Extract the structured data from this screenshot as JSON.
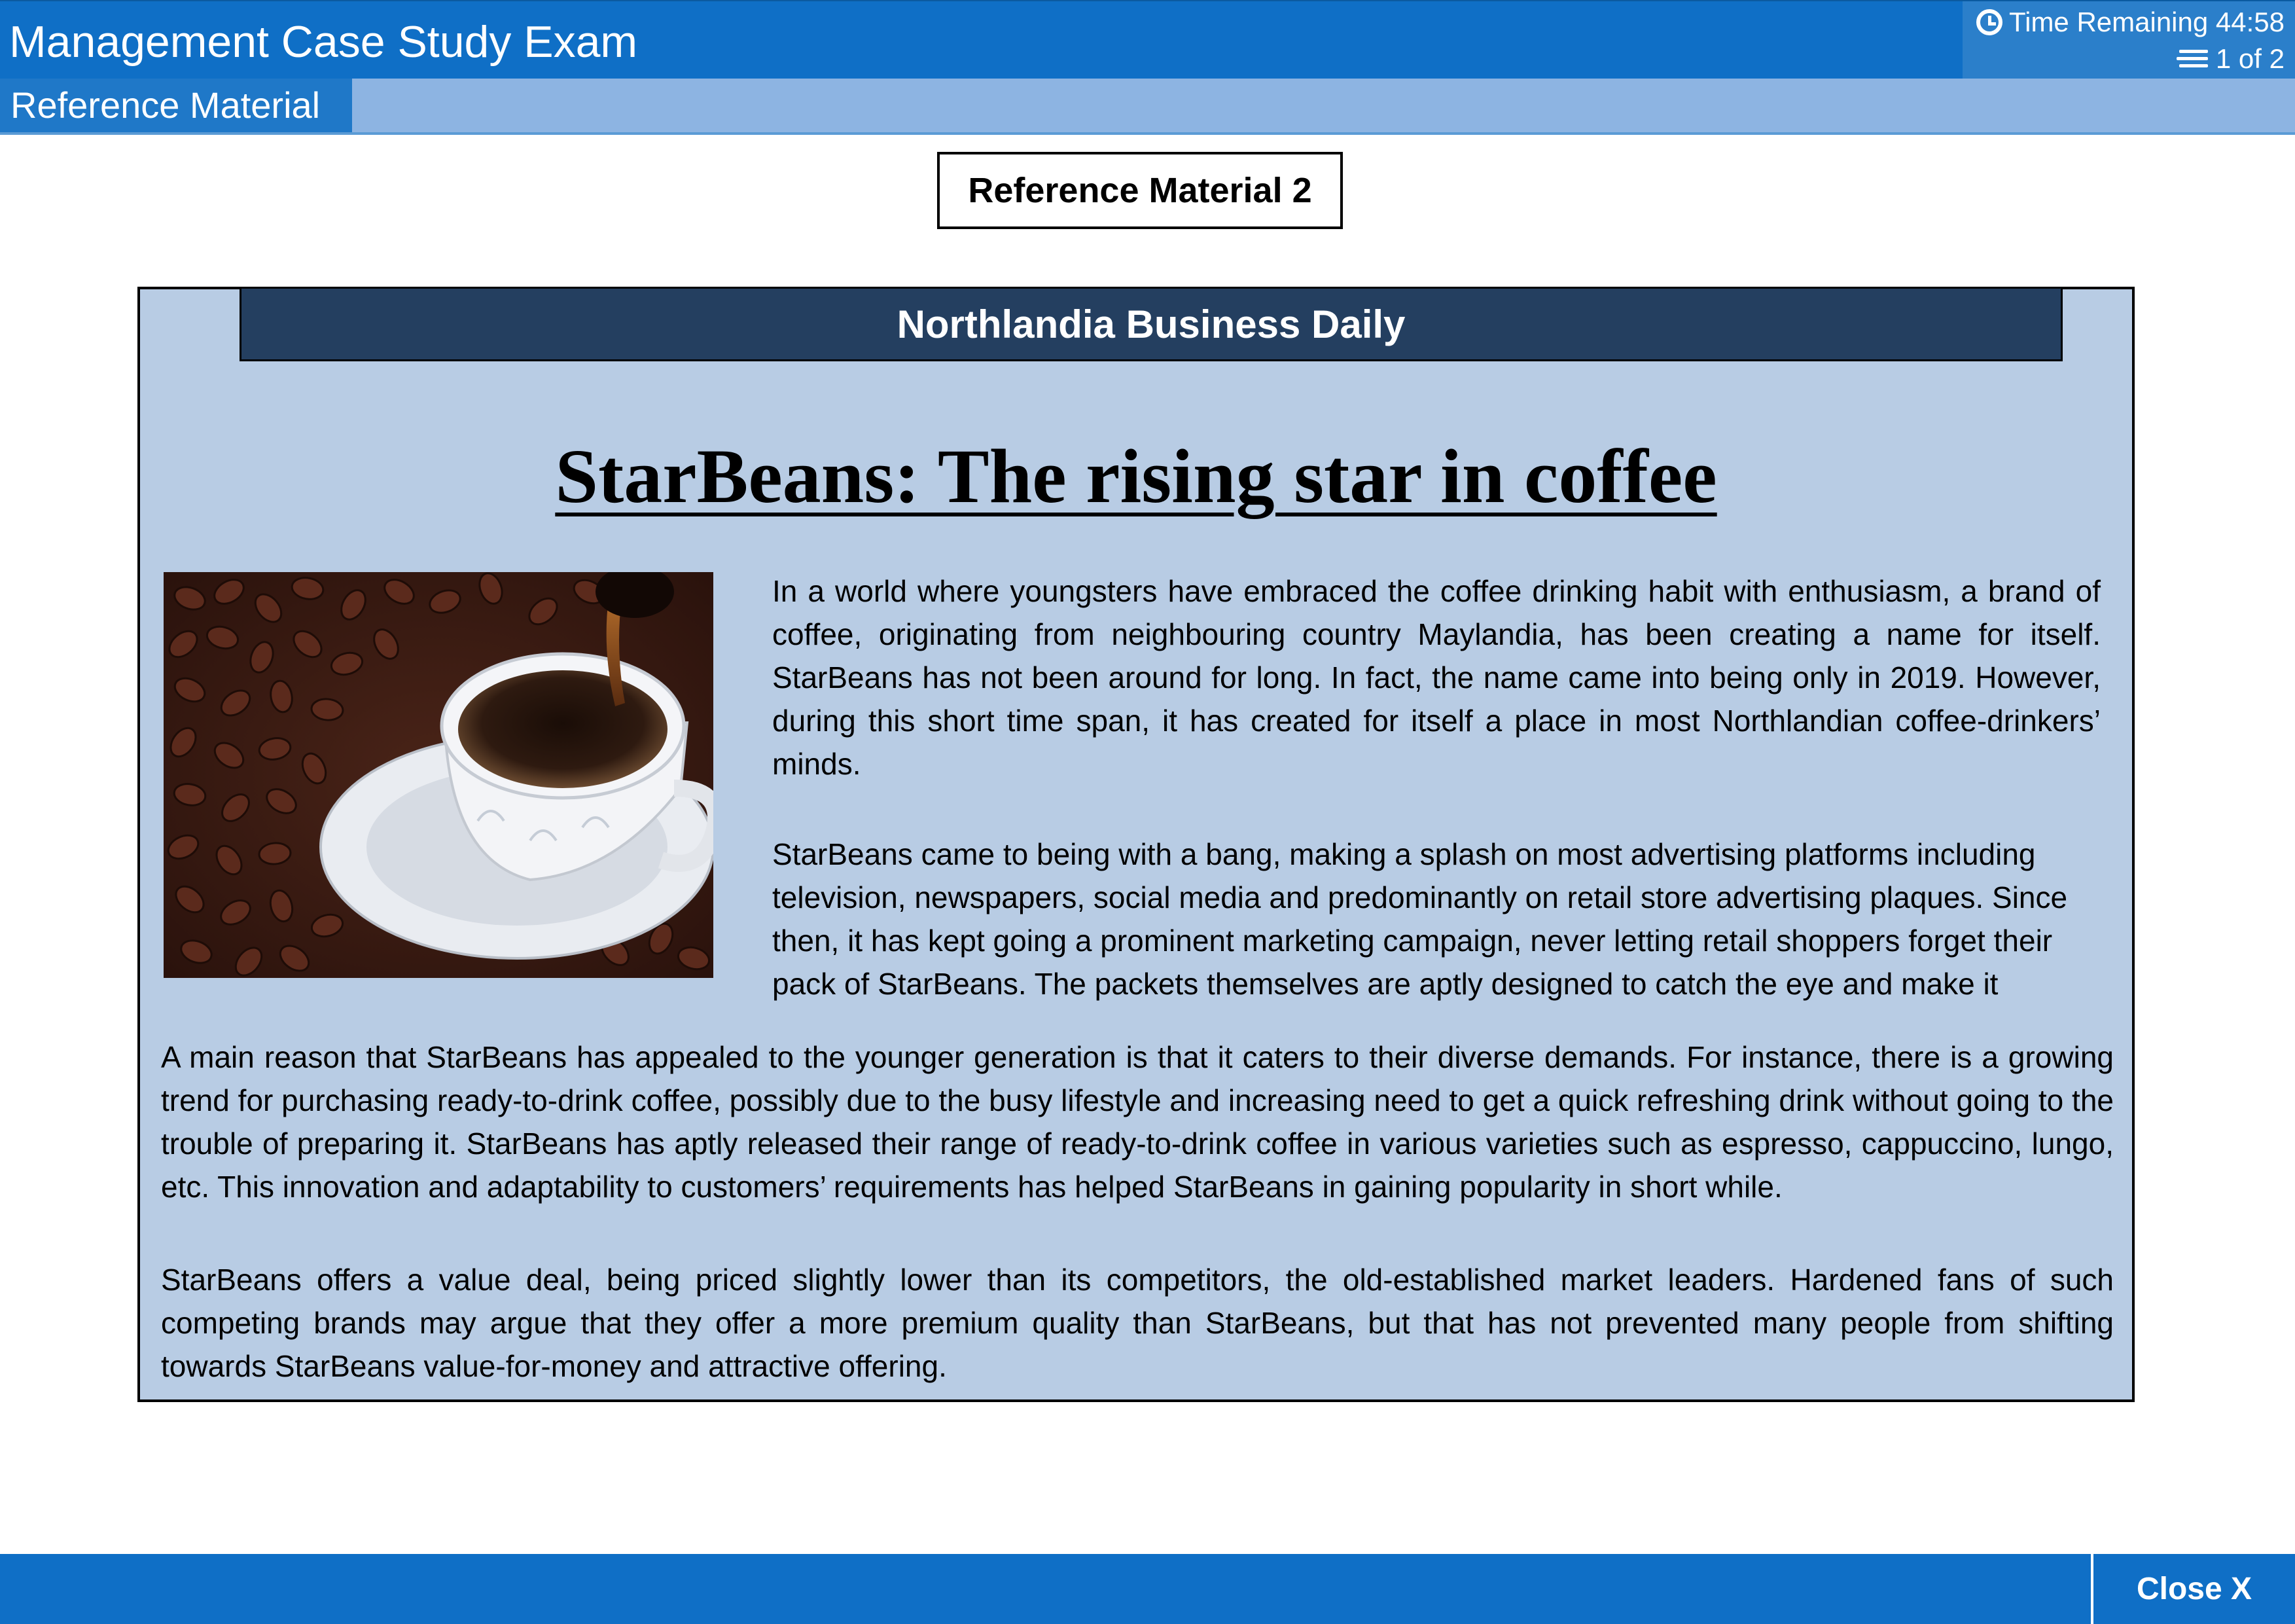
{
  "header": {
    "app_title": "Management Case Study Exam",
    "timer_label": "Time Remaining 44:58",
    "page_indicator": "1 of 2",
    "timer_icon": "clock-icon",
    "page_icon": "pages-icon"
  },
  "tabs": {
    "active_label": "Reference Material"
  },
  "main": {
    "reference_title": "Reference Material 2",
    "newspaper_name": "Northlandia Business Daily",
    "headline": "StarBeans: The rising star in coffee",
    "image_description_icon": "coffee-photo",
    "paragraphs": [
      "In a world where youngsters have embraced the coffee drinking habit with enthusiasm, a brand of coffee, originating from neighbouring country Maylandia, has been creating a name for itself. StarBeans has not been around for long. In fact, the name came into being only in 2019. However, during this short time span, it has created for itself a place in most Northlandian coffee-drinkers’ minds.",
      "StarBeans came to being with a bang, making a splash on most advertising platforms including television, newspapers, social media and predominantly on retail store advertising plaques. Since then, it has kept going a prominent marketing campaign, never letting retail shoppers forget their pack of StarBeans. The packets themselves are aptly designed to catch the eye and make it",
      "A main reason that StarBeans has appealed to the younger generation is that it caters to their diverse demands. For instance, there is a growing trend for purchasing ready-to-drink coffee, possibly due to the busy lifestyle and increasing need to get a quick refreshing drink without going to the trouble of preparing it. StarBeans has aptly released their range of ready-to-drink coffee in various varieties such as espresso, cappuccino, lungo, etc. This innovation and adaptability to customers’ requirements has helped StarBeans in gaining popularity in short while.",
      "StarBeans offers a value deal, being priced slightly lower than its competitors, the old-established market leaders. Hardened fans of such competing brands may argue that they offer a more premium quality than StarBeans, but that has not prevented many people from shifting towards StarBeans value-for-money and attractive offering."
    ]
  },
  "footer": {
    "close_label": "Close X"
  },
  "colors": {
    "header_blue": "#0f6fc6",
    "tab_strip": "#8db4e2",
    "article_bg": "#b8cce4",
    "banner_navy": "#243f60"
  }
}
